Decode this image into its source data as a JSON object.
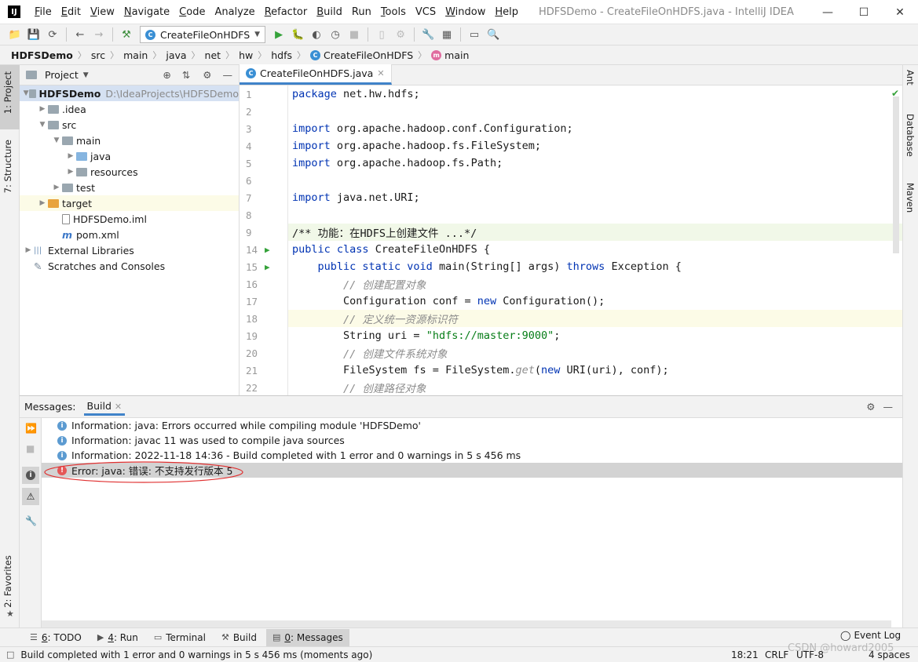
{
  "titlebar": {
    "logo": "IJ",
    "menu": [
      {
        "mn": "F",
        "rest": "ile"
      },
      {
        "mn": "E",
        "rest": "dit"
      },
      {
        "mn": "V",
        "rest": "iew"
      },
      {
        "mn": "N",
        "rest": "avigate"
      },
      {
        "mn": "C",
        "rest": "ode"
      },
      {
        "mn": "",
        "rest": "Analyze"
      },
      {
        "mn": "R",
        "rest": "efactor"
      },
      {
        "mn": "B",
        "rest": "uild"
      },
      {
        "mn": "",
        "rest": "Run"
      },
      {
        "mn": "T",
        "rest": "ools"
      },
      {
        "mn": "",
        "rest": "VCS"
      },
      {
        "mn": "W",
        "rest": "indow"
      },
      {
        "mn": "H",
        "rest": "elp"
      }
    ],
    "window_title": "HDFSDemo - CreateFileOnHDFS.java - IntelliJ IDEA"
  },
  "toolbar": {
    "run_config": "CreateFileOnHDFS"
  },
  "breadcrumb": [
    "HDFSDemo",
    "src",
    "main",
    "java",
    "net",
    "hw",
    "hdfs",
    "CreateFileOnHDFS",
    "main"
  ],
  "left_strip": {
    "project": "1: Project",
    "structure": "7: Structure",
    "favorites": "2: Favorites"
  },
  "right_strip": {
    "ant": "Ant",
    "database": "Database",
    "maven": "Maven"
  },
  "project_panel": {
    "title": "Project",
    "tree": [
      {
        "label": "HDFSDemo",
        "extra": "D:\\IdeaProjects\\HDFSDemo",
        "indent": 0,
        "arrow": "▼",
        "icon": "gray",
        "bold": true,
        "sel": true
      },
      {
        "label": ".idea",
        "extra": "",
        "indent": 1,
        "arrow": "▶",
        "icon": "gray"
      },
      {
        "label": "src",
        "extra": "",
        "indent": 1,
        "arrow": "▼",
        "icon": "gray"
      },
      {
        "label": "main",
        "extra": "",
        "indent": 2,
        "arrow": "▼",
        "icon": "gray"
      },
      {
        "label": "java",
        "extra": "",
        "indent": 3,
        "arrow": "▶",
        "icon": "blue"
      },
      {
        "label": "resources",
        "extra": "",
        "indent": 3,
        "arrow": "▶",
        "icon": "gray"
      },
      {
        "label": "test",
        "extra": "",
        "indent": 2,
        "arrow": "▶",
        "icon": "gray"
      },
      {
        "label": "target",
        "extra": "",
        "indent": 1,
        "arrow": "▶",
        "icon": "orange",
        "hl": true
      },
      {
        "label": "HDFSDemo.iml",
        "extra": "",
        "indent": 2,
        "arrow": "",
        "icon": "file"
      },
      {
        "label": "pom.xml",
        "extra": "",
        "indent": 2,
        "arrow": "",
        "icon": "maven"
      },
      {
        "label": "External Libraries",
        "extra": "",
        "indent": 0,
        "arrow": "▶",
        "icon": "lib"
      },
      {
        "label": "Scratches and Consoles",
        "extra": "",
        "indent": 0,
        "arrow": "",
        "icon": "scratch"
      }
    ]
  },
  "editor": {
    "tab_label": "CreateFileOnHDFS.java",
    "lines": [
      {
        "n": "1",
        "parts": [
          [
            "kw",
            "package"
          ],
          [
            "",
            "net.hw.hdfs;"
          ]
        ]
      },
      {
        "n": "2",
        "parts": []
      },
      {
        "n": "3",
        "parts": [
          [
            "kw",
            "import"
          ],
          [
            "",
            "org.apache.hadoop.conf.Configuration;"
          ]
        ]
      },
      {
        "n": "4",
        "parts": [
          [
            "kw",
            "import"
          ],
          [
            "",
            "org.apache.hadoop.fs.FileSystem;"
          ]
        ]
      },
      {
        "n": "5",
        "parts": [
          [
            "kw",
            "import"
          ],
          [
            "",
            "org.apache.hadoop.fs.Path;"
          ]
        ]
      },
      {
        "n": "6",
        "parts": []
      },
      {
        "n": "7",
        "parts": [
          [
            "kw",
            "import"
          ],
          [
            "",
            "java.net.URI;"
          ]
        ]
      },
      {
        "n": "8",
        "parts": []
      },
      {
        "n": "9",
        "parts": [
          [
            "",
            "/** 功能：在HDFS上创建文件 ...*/"
          ]
        ],
        "fold": true
      },
      {
        "n": "14",
        "parts": [
          [
            "kw",
            "public class"
          ],
          [
            "",
            "CreateFileOnHDFS {"
          ]
        ],
        "run": true
      },
      {
        "n": "15",
        "parts": [
          [
            "",
            "    "
          ],
          [
            "kw",
            "public static void"
          ],
          [
            "",
            "main(String[] args) "
          ],
          [
            "kw",
            "throws"
          ],
          [
            "",
            "Exception {"
          ]
        ],
        "run": true
      },
      {
        "n": "16",
        "parts": [
          [
            "",
            "        "
          ],
          [
            "cmt",
            "// 创建配置对象"
          ]
        ]
      },
      {
        "n": "17",
        "parts": [
          [
            "",
            "        Configuration conf = "
          ],
          [
            "kw",
            "new"
          ],
          [
            "",
            "Configuration();"
          ]
        ]
      },
      {
        "n": "18",
        "parts": [
          [
            "",
            "        "
          ],
          [
            "cmt",
            "// 定义统一资源标识符"
          ]
        ],
        "hl": true
      },
      {
        "n": "19",
        "parts": [
          [
            "",
            "        String uri = "
          ],
          [
            "str",
            "\"hdfs://master:9000\""
          ],
          [
            "",
            ";"
          ]
        ]
      },
      {
        "n": "20",
        "parts": [
          [
            "",
            "        "
          ],
          [
            "cmt",
            "// 创建文件系统对象"
          ]
        ]
      },
      {
        "n": "21",
        "parts": [
          [
            "",
            "        FileSystem fs = FileSystem."
          ],
          [
            "cmt",
            "get"
          ],
          [
            "",
            "("
          ],
          [
            "kw",
            "new"
          ],
          [
            "",
            "URI(uri), conf);"
          ]
        ]
      },
      {
        "n": "22",
        "parts": [
          [
            "",
            "        "
          ],
          [
            "cmt",
            "// 创建路径对象"
          ]
        ]
      }
    ]
  },
  "messages": {
    "label": "Messages:",
    "tab": "Build",
    "rows": [
      {
        "type": "info",
        "text": "Information: java: Errors occurred while compiling module 'HDFSDemo'"
      },
      {
        "type": "info",
        "text": "Information: javac 11 was used to compile java sources"
      },
      {
        "type": "info",
        "text": "Information: 2022-11-18 14:36 - Build completed with 1 error and 0 warnings in 5 s 456 ms"
      },
      {
        "type": "error",
        "text": "Error: java: 错误: 不支持发行版本 5"
      }
    ]
  },
  "bottom_tabs": [
    {
      "icon": "list-icon",
      "mn": "6",
      "rest": ": TODO",
      "active": false
    },
    {
      "icon": "play-icon",
      "mn": "4",
      "rest": ": Run",
      "active": false
    },
    {
      "icon": "terminal-icon",
      "mn": "",
      "rest": "Terminal",
      "active": false
    },
    {
      "icon": "hammer-icon",
      "mn": "",
      "rest": "Build",
      "active": false
    },
    {
      "icon": "messages-icon",
      "mn": "0",
      "rest": ": Messages",
      "active": true
    }
  ],
  "event_log": "Event Log",
  "statusbar": {
    "message": "Build completed with 1 error and 0 warnings in 5 s 456 ms (moments ago)",
    "position": "18:21",
    "line_sep": "CRLF",
    "encoding": "UTF-8",
    "indent": "4 spaces",
    "watermark": "CSDN @howard2005"
  },
  "colors": {
    "accent": "#4083c9",
    "error": "#e55757",
    "info": "#5c9bd1",
    "run_green": "#35a23a"
  }
}
